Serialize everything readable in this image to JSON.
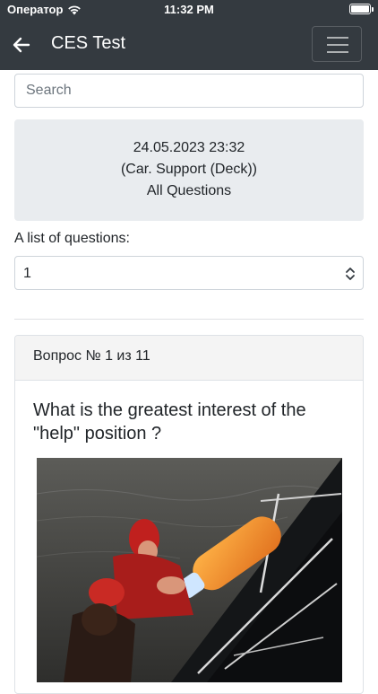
{
  "status_bar": {
    "carrier": "Оператор",
    "time": "11:32 PM"
  },
  "nav": {
    "title": "CES Test",
    "back_icon": "arrow-left-icon",
    "menu_icon": "hamburger-icon"
  },
  "search": {
    "placeholder": "Search",
    "value": ""
  },
  "info": {
    "date": "24.05.2023 23:32",
    "category": "(Car. Support (Deck))",
    "scope": "All Questions"
  },
  "list": {
    "label": "A list of questions:",
    "selected": "1"
  },
  "card": {
    "header": "Вопрос № 1 из 11",
    "question": "What is the greatest interest of the \"help\" position ?"
  },
  "colors": {
    "navbar": "#343a40",
    "info_bg": "#e9ecef",
    "card_header_bg": "#f4f4f4"
  }
}
